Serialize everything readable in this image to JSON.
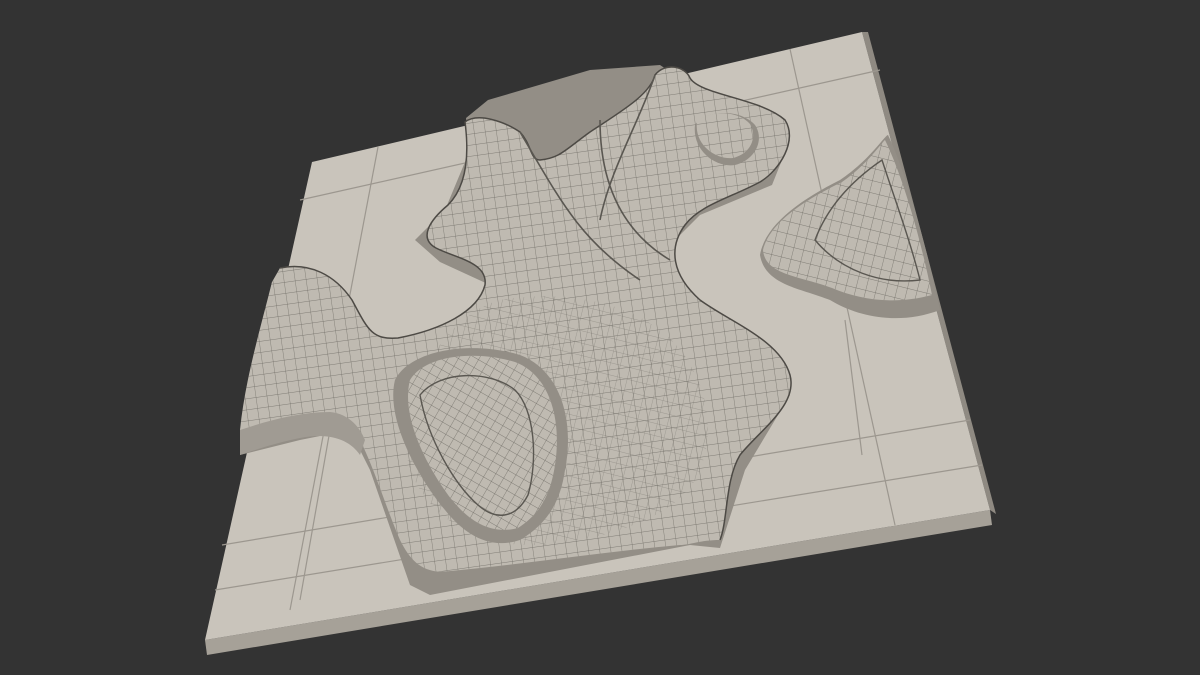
{
  "scene": {
    "background_color": "#333333",
    "slab_top_color": "#c9c4bb",
    "slab_front_color": "#a6a198",
    "slab_right_color": "#8f8a82",
    "tile_line_color": "#9c978f",
    "mesh_fill_color": "#bfbab1",
    "mesh_line_color": "#6c6962",
    "ledge_color": "#938e86",
    "shadow_color": "#5a5751"
  }
}
